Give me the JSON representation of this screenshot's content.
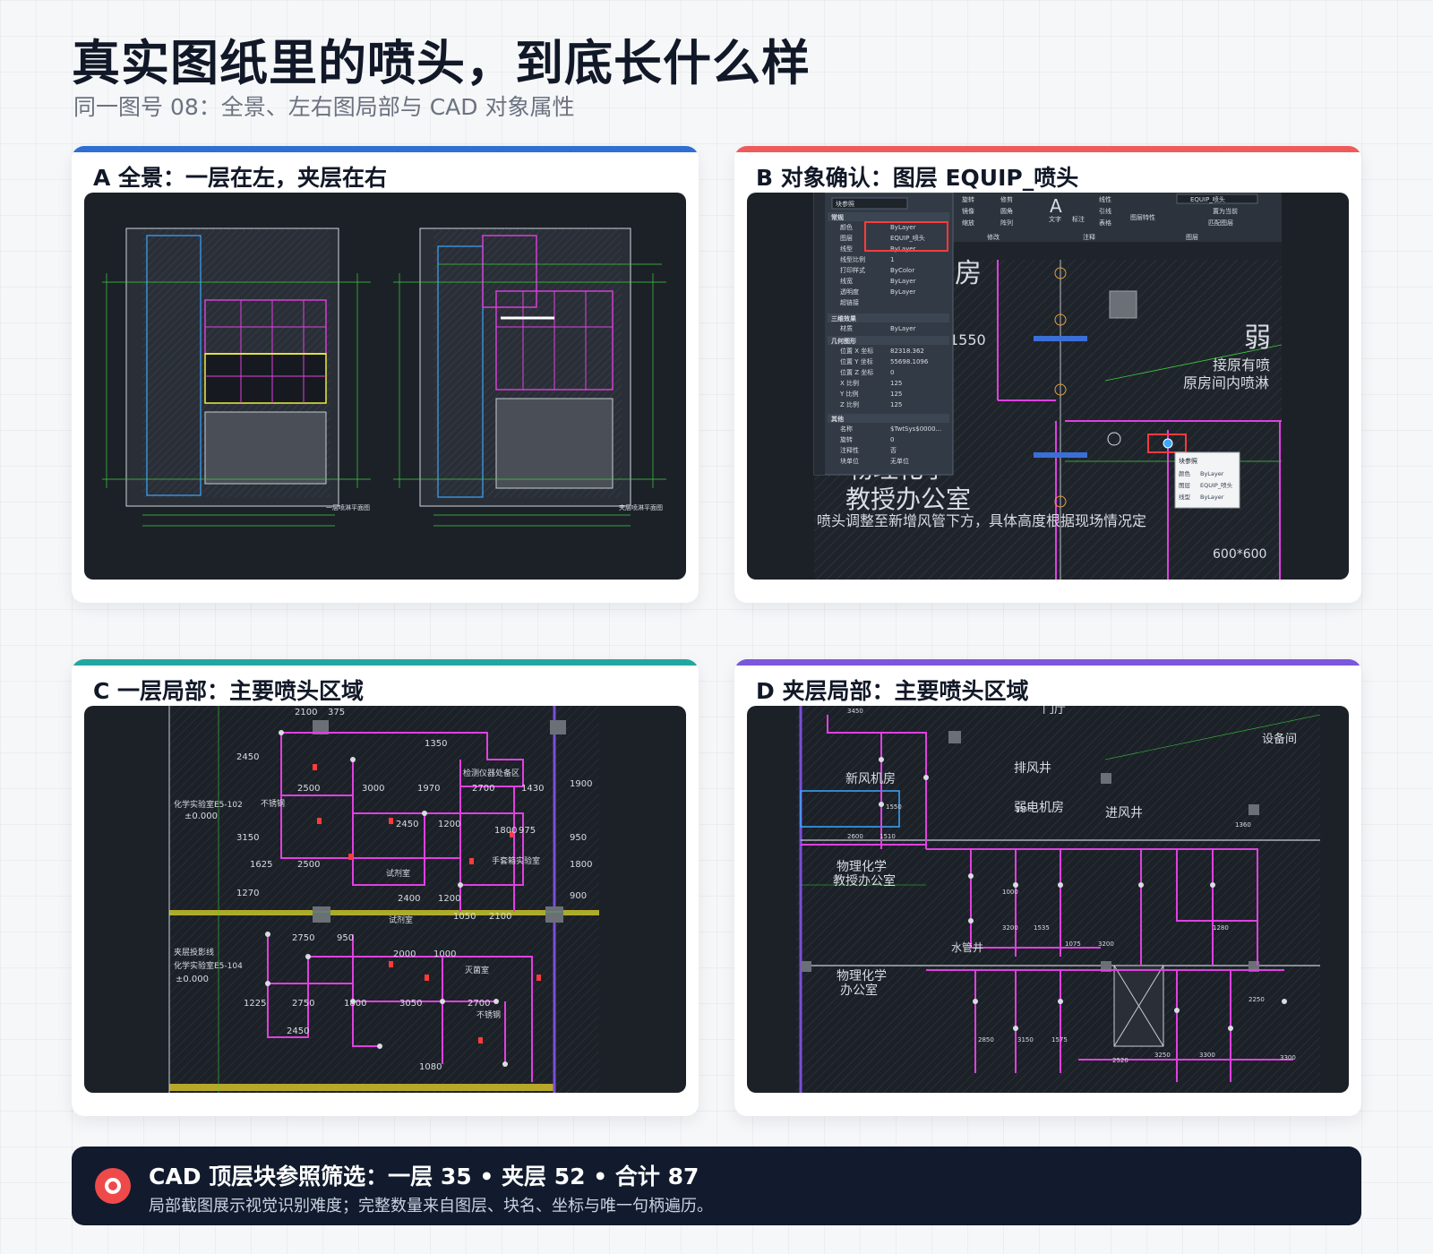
{
  "header": {
    "title": "真实图纸里的喷头，到底长什么样",
    "subtitle": "同一图号 08：全景、左右图局部与 CAD 对象属性"
  },
  "colors": {
    "card_a": "#2f6fd1",
    "card_b": "#ef5b5b",
    "card_c": "#20a8a0",
    "card_d": "#7b57db",
    "footer_bg": "#111b2d",
    "footer_icon": "#ef4a4a"
  },
  "cards": [
    {
      "id": "A",
      "title": "A 全景：一层在左，夹层在右",
      "drawing": {
        "left_sheet_label": "一层喷淋平面图",
        "right_sheet_label": "夹层喷淋平面图"
      }
    },
    {
      "id": "B",
      "title": "B 对象确认：图层 EQUIP_喷头",
      "properties_panel": {
        "selector": "块参照",
        "sections": {
          "general": "常规",
          "3d": "三维效果",
          "geometry": "几何图形",
          "misc": "其他"
        },
        "rows": [
          {
            "label": "颜色",
            "value": "ByLayer"
          },
          {
            "label": "图层",
            "value": "EQUIP_喷头"
          },
          {
            "label": "线型",
            "value": "ByLayer"
          },
          {
            "label": "线型比例",
            "value": "1"
          },
          {
            "label": "打印样式",
            "value": "ByColor"
          },
          {
            "label": "线宽",
            "value": "ByLayer"
          },
          {
            "label": "透明度",
            "value": "ByLayer"
          },
          {
            "label": "超链接",
            "value": ""
          }
        ],
        "material": {
          "label": "材质",
          "value": "ByLayer"
        },
        "geometry_rows": [
          {
            "label": "位置 X 坐标",
            "value": "82318.362"
          },
          {
            "label": "位置 Y 坐标",
            "value": "55698.1096"
          },
          {
            "label": "位置 Z 坐标",
            "value": "0"
          },
          {
            "label": "X 比例",
            "value": "125"
          },
          {
            "label": "Y 比例",
            "value": "125"
          },
          {
            "label": "Z 比例",
            "value": "125"
          }
        ],
        "misc_rows": [
          {
            "label": "名称",
            "value": "$TwtSys$0000..."
          },
          {
            "label": "旋转",
            "value": "0"
          },
          {
            "label": "注释性",
            "value": "否"
          },
          {
            "label": "块单位",
            "value": "无单位"
          }
        ]
      },
      "ribbon": {
        "tools": [
          "旋转",
          "修剪",
          "镜像",
          "圆角",
          "缩放",
          "阵列"
        ],
        "groups": [
          "修改",
          "注释",
          "图层"
        ],
        "text_label": "文字",
        "dim_label": "标注",
        "layer_props": "图层特性",
        "layer_value": "EQUIP_喷头",
        "linear": "线性",
        "leader": "引线",
        "table": "表格",
        "set_current": "置为当前",
        "match_layer": "匹配图层"
      },
      "tooltip": {
        "title": "块参照",
        "rows": [
          {
            "label": "颜色",
            "value": "ByLayer"
          },
          {
            "label": "图层",
            "value": "EQUIP_喷头"
          },
          {
            "label": "线型",
            "value": "ByLayer"
          }
        ]
      },
      "drawing_text": {
        "room_1": "房",
        "room_2": "物理化学",
        "room_3": "教授办公室",
        "note_1": "弱",
        "note_2": "接原有喷",
        "note_3": "原房间内喷淋",
        "note_4": "喷头调整至新增风管下方，具体高度根据现场情况定",
        "dim_1": "1550",
        "dim_2": "600*600"
      }
    },
    {
      "id": "C",
      "title": "C 一层局部：主要喷头区域",
      "drawing_text": {
        "room_a": "化学实验室",
        "room_a_code": "E5-102",
        "elev": "±0.000",
        "room_b": "化学实验室",
        "room_b_code": "E5-104",
        "mezz": "夹层投影线",
        "label_1": "检测仪器处备区",
        "label_2": "不锈钢",
        "label_3": "试剂室",
        "label_4": "手套箱实验室",
        "label_5": "灭菌室",
        "label_6": "不锈钢",
        "dims": [
          "2100",
          "375",
          "1350",
          "2500",
          "3000",
          "1970",
          "2700",
          "1430",
          "2450",
          "1200",
          "1800",
          "975",
          "1625",
          "2500",
          "2400",
          "1200",
          "1050",
          "2100",
          "2750",
          "950",
          "2000",
          "1000",
          "1225",
          "2750",
          "1800",
          "3050",
          "2700",
          "2450",
          "1080",
          "2450",
          "3150",
          "1270",
          "1900",
          "950",
          "1800",
          "900"
        ]
      }
    },
    {
      "id": "D",
      "title": "D 夹层局部：主要喷头区域",
      "drawing_text": {
        "room_1": "新风机房",
        "room_2": "排风井",
        "room_3": "弱电机房",
        "room_4": "进风井",
        "room_5": "物理化学",
        "room_6": "教授办公室",
        "room_7": "物理化学",
        "room_8": "办公室",
        "room_9": "水管井",
        "room_10": "设备间",
        "room_11": "门厅",
        "dims": [
          "3450",
          "1550",
          "2600",
          "1510",
          "1000",
          "1550",
          "3200",
          "1535",
          "1075",
          "3200",
          "2850",
          "3150",
          "1575",
          "2520",
          "3250",
          "3300",
          "2250",
          "1280",
          "1360",
          "3300"
        ]
      }
    }
  ],
  "footer": {
    "title": "CAD 顶层块参照筛选：一层 35 • 夹层 52 • 合计 87",
    "text": "局部截图展示视觉识别难度；完整数量来自图层、块名、坐标与唯一句柄遍历。"
  }
}
